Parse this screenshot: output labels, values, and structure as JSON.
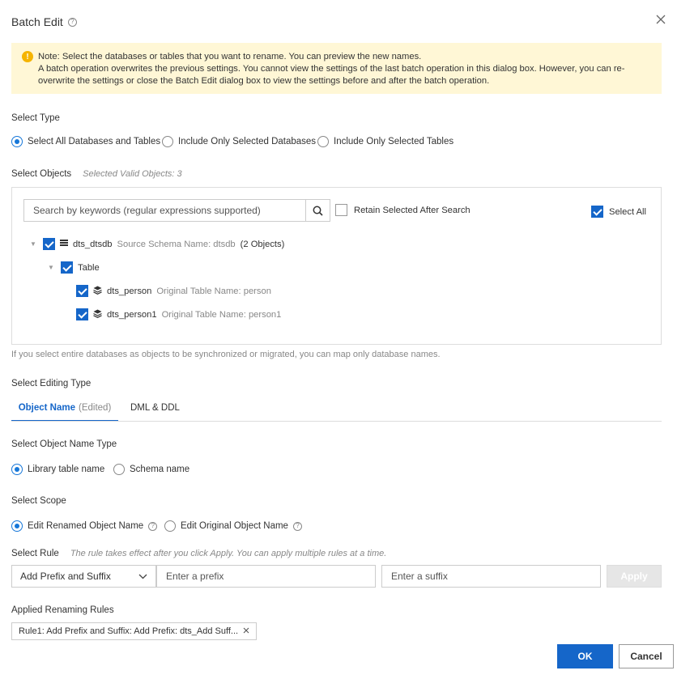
{
  "dialog": {
    "title": "Batch Edit",
    "help_icon": "?"
  },
  "notice": {
    "line1": "Note: Select the databases or tables that you want to rename. You can preview the new names.",
    "line2": "A batch operation overwrites the previous settings. You cannot view the settings of the last batch operation in this dialog box. However, you can re-overwrite the settings or close the Batch Edit dialog box to view the settings before and after the batch operation."
  },
  "select_type": {
    "label": "Select Type",
    "options": [
      "Select All Databases and Tables",
      "Include Only Selected Databases",
      "Include Only Selected Tables"
    ],
    "selected": 0
  },
  "select_objects": {
    "label": "Select Objects",
    "hint": "Selected Valid Objects: 3",
    "search_placeholder": "Search by keywords (regular expressions supported)",
    "retain_label": "Retain Selected After Search",
    "select_all_label": "Select All",
    "tree": {
      "db_name": "dts_dtsdb",
      "db_meta": "Source Schema Name: dtsdb",
      "db_count": "(2 Objects)",
      "group": "Table",
      "tables": [
        {
          "name": "dts_person",
          "meta": "Original Table Name: person"
        },
        {
          "name": "dts_person1",
          "meta": "Original Table Name: person1"
        }
      ]
    },
    "footnote": "If you select entire databases as objects to be synchronized or migrated, you can map only database names."
  },
  "editing_type": {
    "label": "Select Editing Type",
    "tab1": "Object Name",
    "tab1_suffix": "(Edited)",
    "tab2": "DML & DDL"
  },
  "object_name_type": {
    "label": "Select Object Name Type",
    "options": [
      "Library table name",
      "Schema name"
    ],
    "selected": 0
  },
  "scope": {
    "label": "Select Scope",
    "options": [
      "Edit Renamed Object Name",
      "Edit Original Object Name"
    ],
    "selected": 0
  },
  "rule": {
    "label": "Select Rule",
    "hint": "The rule takes effect after you click Apply. You can apply multiple rules at a time.",
    "select_value": "Add Prefix and Suffix",
    "prefix_placeholder": "Enter a prefix",
    "suffix_placeholder": "Enter a suffix",
    "apply_label": "Apply"
  },
  "applied": {
    "label": "Applied Renaming Rules",
    "rule1": "Rule1: Add Prefix and Suffix:  Add Prefix: dts_Add Suff..."
  },
  "footer": {
    "ok_label": "OK",
    "cancel_label": "Cancel"
  }
}
